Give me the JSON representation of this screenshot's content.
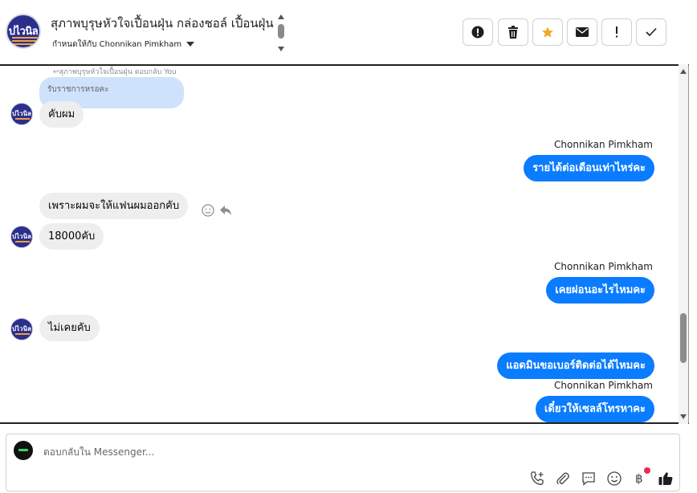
{
  "header": {
    "title": "สุภาพบุรุษหัวใจเปื้อนฝุ่น กล่องชอล์ เปื้อนฝุ่น",
    "assignee_label": "กำหนดให้กับ Chonnikan Pimkham",
    "avatar_text": "ปไวนิล",
    "actions": [
      {
        "name": "report-button",
        "icon": "exclamation-circle-icon"
      },
      {
        "name": "delete-button",
        "icon": "trash-icon"
      },
      {
        "name": "star-button",
        "icon": "star-icon",
        "color": "#f5a623"
      },
      {
        "name": "mail-button",
        "icon": "envelope-icon"
      },
      {
        "name": "flag-button",
        "icon": "exclamation-icon"
      },
      {
        "name": "done-button",
        "icon": "checkmark-icon"
      }
    ]
  },
  "conversation": {
    "reply_caption": "↩สุภาพบุรุษหัวใจเปื้อนฝุ่น ตอบกลับ You",
    "quoted_text": "รับราชการหรอคะ",
    "messages": [
      {
        "direction": "in",
        "text": "คับผม"
      },
      {
        "direction": "out",
        "sender": "Chonnikan Pimkham",
        "text": "รายได้ต่อเดือนเท่าไหร่คะ"
      },
      {
        "direction": "in",
        "text": "เพราะผมจะให้แฟนผมออกคับ"
      },
      {
        "direction": "in",
        "text": "18000คับ"
      },
      {
        "direction": "out",
        "sender": "Chonnikan Pimkham",
        "text": "เคยผ่อนอะไรไหมคะ"
      },
      {
        "direction": "in",
        "text": "ไม่เคยคับ"
      },
      {
        "direction": "out",
        "text": "แอดมินขอเบอร์ติดต่อได้ไหมคะ"
      },
      {
        "direction": "out",
        "sender": "Chonnikan Pimkham",
        "text": "เดี๋ยวให้เซลล์โทรหาคะ"
      }
    ]
  },
  "composer": {
    "placeholder": "ตอบกลับใน Messenger...",
    "icons": [
      "phone-plus-icon",
      "paperclip-icon",
      "saved-reply-icon",
      "emoji-icon",
      "baht-icon",
      "thumbs-up-icon"
    ]
  },
  "colors": {
    "outgoing_bubble": "#0a7cff",
    "incoming_bubble": "#eeeeee",
    "quoted_bubble": "#cfe2fb",
    "star": "#f5a623",
    "notification": "#f02849"
  }
}
